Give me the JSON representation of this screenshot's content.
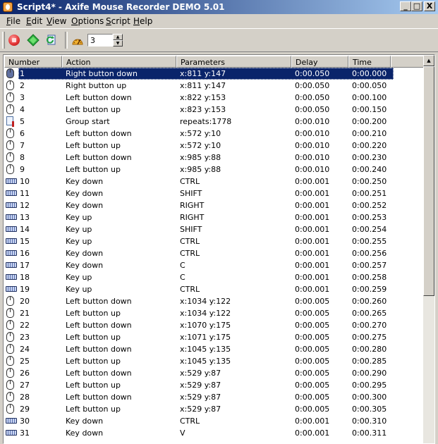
{
  "window": {
    "title": "Script4* - Axife Mouse Recorder DEMO 5.01",
    "minimize": "_",
    "maximize": "□",
    "close": "X"
  },
  "menu": [
    {
      "pre": "",
      "key": "F",
      "post": "ile"
    },
    {
      "pre": "",
      "key": "E",
      "post": "dit"
    },
    {
      "pre": "",
      "key": "V",
      "post": "iew"
    },
    {
      "pre": "",
      "key": "O",
      "post": "ptions"
    },
    {
      "pre": "",
      "key": "S",
      "post": "cript"
    },
    {
      "pre": "",
      "key": "H",
      "post": "elp"
    }
  ],
  "toolbar": {
    "repeat_count": "3",
    "spin_up": "▲",
    "spin_down": "▼"
  },
  "columns": [
    "Number",
    "Action",
    "Parameters",
    "Delay",
    "Time"
  ],
  "colors": {
    "selection": "#0a246a",
    "title_start": "#0a246a",
    "title_end": "#a6caf0"
  },
  "rows": [
    {
      "num": "1",
      "icon": "mouse-icon",
      "action": "Right button down",
      "params": "x:811 y:147",
      "delay": "0:00.050",
      "time": "0:00.000"
    },
    {
      "num": "2",
      "icon": "mouse-icon",
      "action": "Right button up",
      "params": "x:811 y:147",
      "delay": "0:00.050",
      "time": "0:00.050"
    },
    {
      "num": "3",
      "icon": "mouse-icon",
      "action": "Left button down",
      "params": "x:822 y:153",
      "delay": "0:00.050",
      "time": "0:00.100"
    },
    {
      "num": "4",
      "icon": "mouse-icon",
      "action": "Left button up",
      "params": "x:823 y:153",
      "delay": "0:00.050",
      "time": "0:00.150"
    },
    {
      "num": "5",
      "icon": "group-icon",
      "action": "Group start",
      "params": "repeats:1778",
      "delay": "0:00.010",
      "time": "0:00.200"
    },
    {
      "num": "6",
      "icon": "mouse-icon",
      "action": "Left button down",
      "params": "x:572 y:10",
      "delay": "0:00.010",
      "time": "0:00.210"
    },
    {
      "num": "7",
      "icon": "mouse-icon",
      "action": "Left button up",
      "params": "x:572 y:10",
      "delay": "0:00.010",
      "time": "0:00.220"
    },
    {
      "num": "8",
      "icon": "mouse-icon",
      "action": "Left button down",
      "params": "x:985 y:88",
      "delay": "0:00.010",
      "time": "0:00.230"
    },
    {
      "num": "9",
      "icon": "mouse-icon",
      "action": "Left button up",
      "params": "x:985 y:88",
      "delay": "0:00.010",
      "time": "0:00.240"
    },
    {
      "num": "10",
      "icon": "keyboard-icon",
      "action": "Key down",
      "params": "CTRL",
      "delay": "0:00.001",
      "time": "0:00.250"
    },
    {
      "num": "11",
      "icon": "keyboard-icon",
      "action": "Key down",
      "params": "SHIFT",
      "delay": "0:00.001",
      "time": "0:00.251"
    },
    {
      "num": "12",
      "icon": "keyboard-icon",
      "action": "Key down",
      "params": "RIGHT",
      "delay": "0:00.001",
      "time": "0:00.252"
    },
    {
      "num": "13",
      "icon": "keyboard-icon",
      "action": "Key up",
      "params": "RIGHT",
      "delay": "0:00.001",
      "time": "0:00.253"
    },
    {
      "num": "14",
      "icon": "keyboard-icon",
      "action": "Key up",
      "params": "SHIFT",
      "delay": "0:00.001",
      "time": "0:00.254"
    },
    {
      "num": "15",
      "icon": "keyboard-icon",
      "action": "Key up",
      "params": "CTRL",
      "delay": "0:00.001",
      "time": "0:00.255"
    },
    {
      "num": "16",
      "icon": "keyboard-icon",
      "action": "Key down",
      "params": "CTRL",
      "delay": "0:00.001",
      "time": "0:00.256"
    },
    {
      "num": "17",
      "icon": "keyboard-icon",
      "action": "Key down",
      "params": "C",
      "delay": "0:00.001",
      "time": "0:00.257"
    },
    {
      "num": "18",
      "icon": "keyboard-icon",
      "action": "Key up",
      "params": "C",
      "delay": "0:00.001",
      "time": "0:00.258"
    },
    {
      "num": "19",
      "icon": "keyboard-icon",
      "action": "Key up",
      "params": "CTRL",
      "delay": "0:00.001",
      "time": "0:00.259"
    },
    {
      "num": "20",
      "icon": "mouse-icon",
      "action": "Left button down",
      "params": "x:1034 y:122",
      "delay": "0:00.005",
      "time": "0:00.260"
    },
    {
      "num": "21",
      "icon": "mouse-icon",
      "action": "Left button up",
      "params": "x:1034 y:122",
      "delay": "0:00.005",
      "time": "0:00.265"
    },
    {
      "num": "22",
      "icon": "mouse-icon",
      "action": "Left button down",
      "params": "x:1070 y:175",
      "delay": "0:00.005",
      "time": "0:00.270"
    },
    {
      "num": "23",
      "icon": "mouse-icon",
      "action": "Left button up",
      "params": "x:1071 y:175",
      "delay": "0:00.005",
      "time": "0:00.275"
    },
    {
      "num": "24",
      "icon": "mouse-icon",
      "action": "Left button down",
      "params": "x:1045 y:135",
      "delay": "0:00.005",
      "time": "0:00.280"
    },
    {
      "num": "25",
      "icon": "mouse-icon",
      "action": "Left button up",
      "params": "x:1045 y:135",
      "delay": "0:00.005",
      "time": "0:00.285"
    },
    {
      "num": "26",
      "icon": "mouse-icon",
      "action": "Left button down",
      "params": "x:529 y:87",
      "delay": "0:00.005",
      "time": "0:00.290"
    },
    {
      "num": "27",
      "icon": "mouse-icon",
      "action": "Left button up",
      "params": "x:529 y:87",
      "delay": "0:00.005",
      "time": "0:00.295"
    },
    {
      "num": "28",
      "icon": "mouse-icon",
      "action": "Left button down",
      "params": "x:529 y:87",
      "delay": "0:00.005",
      "time": "0:00.300"
    },
    {
      "num": "29",
      "icon": "mouse-icon",
      "action": "Left button up",
      "params": "x:529 y:87",
      "delay": "0:00.005",
      "time": "0:00.305"
    },
    {
      "num": "30",
      "icon": "keyboard-icon",
      "action": "Key down",
      "params": "CTRL",
      "delay": "0:00.001",
      "time": "0:00.310"
    },
    {
      "num": "31",
      "icon": "keyboard-icon",
      "action": "Key down",
      "params": "V",
      "delay": "0:00.001",
      "time": "0:00.311"
    }
  ]
}
